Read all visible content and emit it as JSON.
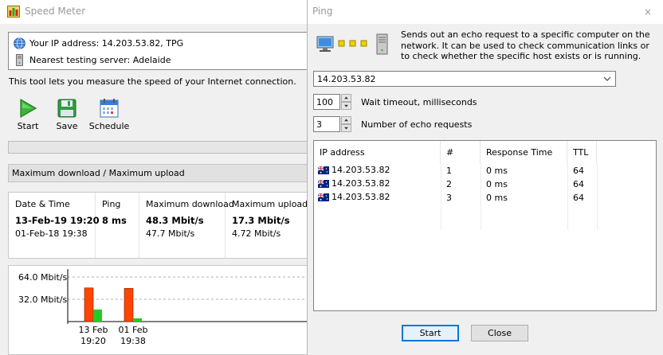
{
  "speed_meter": {
    "title": "Speed Meter",
    "ip_address_text": "Your IP address: 14.203.53.82, TPG",
    "server_text": "Nearest testing server: Adelaide",
    "description": "This tool lets you measure the speed of your Internet connection.",
    "toolbar": {
      "start_label": "Start",
      "save_label": "Save",
      "schedule_label": "Schedule"
    },
    "mode_label": "Maximum download / Maximum upload",
    "results": {
      "headers": [
        "Date & Time",
        "Ping",
        "Maximum download",
        "Maximum upload"
      ],
      "latest": [
        "13-Feb-19 19:20",
        "8 ms",
        "48.3 Mbit/s",
        "17.3 Mbit/s"
      ],
      "previous": [
        "01-Feb-18 19:38",
        "",
        "47.7 Mbit/s",
        "4.72 Mbit/s"
      ]
    },
    "chart_data": {
      "type": "bar",
      "categories": [
        [
          "13 Feb",
          "19:20"
        ],
        [
          "01 Feb",
          "19:38"
        ]
      ],
      "series": [
        {
          "values": [
            48.3,
            47.7
          ],
          "color": "#ff4500"
        },
        {
          "values": [
            17.3,
            4.72
          ],
          "color": "#22cc22"
        }
      ],
      "y_tick_labels": [
        "64.0 Mbit/s",
        "32.0 Mbit/s"
      ],
      "y_ticks": [
        64,
        32
      ],
      "ylim": [
        0,
        80
      ],
      "grid": true
    }
  },
  "ping": {
    "title": "Ping",
    "close_glyph": "×",
    "description": "Sends out an echo request to a specific computer on the network. It can be used to check communication links or to check whether the specific host exists or is running.",
    "host_value": "14.203.53.82",
    "timeout_value": "100",
    "timeout_label": "Wait timeout, milliseconds",
    "count_value": "3",
    "count_label": "Number of echo requests",
    "columns": [
      "IP address",
      "#",
      "Response Time",
      "TTL"
    ],
    "rows": [
      {
        "ip": "14.203.53.82",
        "num": "1",
        "rt": "0 ms",
        "ttl": "64"
      },
      {
        "ip": "14.203.53.82",
        "num": "2",
        "rt": "0 ms",
        "ttl": "64"
      },
      {
        "ip": "14.203.53.82",
        "num": "3",
        "rt": "0 ms",
        "ttl": "64"
      }
    ],
    "start_label": "Start",
    "close_label": "Close"
  }
}
